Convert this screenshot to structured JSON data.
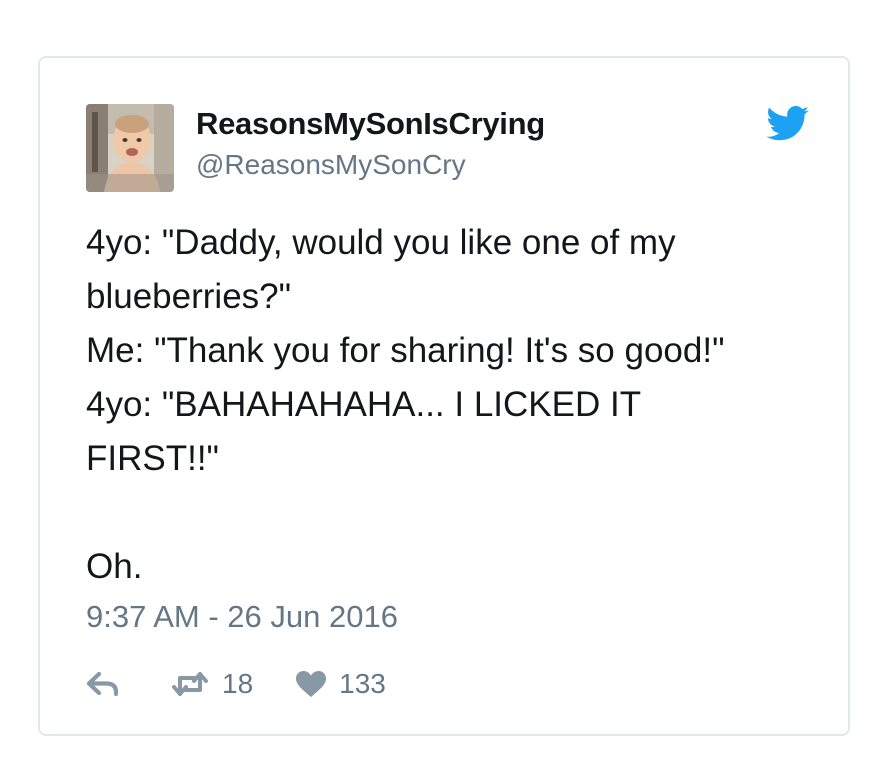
{
  "tweet": {
    "display_name": "ReasonsMySonIsCrying",
    "handle": "@ReasonsMySonCry",
    "text": "4yo: \"Daddy, would you like one of my\nblueberries?\"\nMe: \"Thank you for sharing! It's so good!\"\n4yo: \"BAHAHAHAHA... I LICKED IT\nFIRST!!\"\n\nOh.",
    "timestamp": "9:37 AM - 26 Jun 2016",
    "retweet_count": "18",
    "like_count": "133"
  },
  "icons": {
    "brand": "twitter-bird-icon",
    "reply": "reply-icon",
    "retweet": "retweet-icon",
    "like": "heart-icon"
  },
  "colors": {
    "brand_blue": "#1da1f2",
    "text": "#14171a",
    "secondary_text": "#657786",
    "border": "#e1e8ed",
    "icon_gray": "#8899a6"
  }
}
